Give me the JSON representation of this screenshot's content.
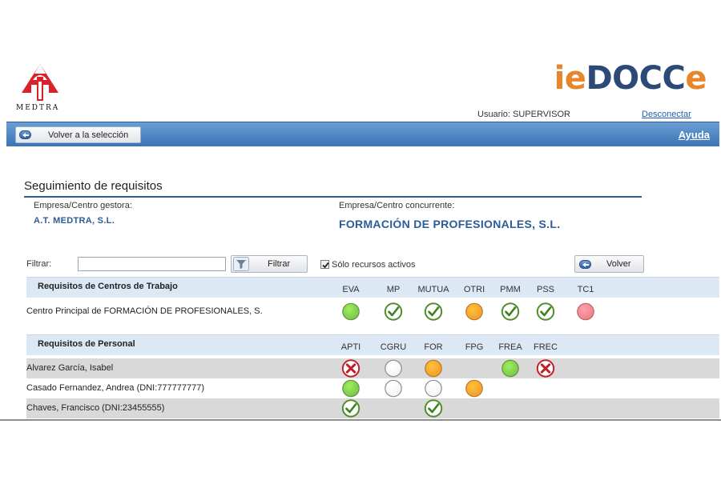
{
  "header": {
    "logo_text": "MEDTRA",
    "brand": {
      "i": "i",
      "doc": "DOC",
      "e": "e"
    },
    "user_label": "Usuario: SUPERVISOR",
    "logout_label": "Desconectar"
  },
  "toolbar": {
    "back_selection_label": "Volver a la selección",
    "help_label": "Ayuda"
  },
  "section": {
    "title": "Seguimiento de requisitos",
    "gestora_label": "Empresa/Centro gestora:",
    "gestora_value": "A.T. MEDTRA, S.L.",
    "concurrente_label": "Empresa/Centro concurrente:",
    "concurrente_value": "FORMACIÓN DE PROFESIONALES, S.L."
  },
  "filter": {
    "label": "Filtrar:",
    "value": "",
    "button_label": "Filtrar",
    "active_only_label": "Sólo recursos activos",
    "active_only_checked": true,
    "back_label": "Volver"
  },
  "status_legend": {
    "ok": "check-icon",
    "fail": "cross-icon",
    "green": "#7cc04a",
    "orange": "#f29a2e",
    "red": "#ee7f88",
    "white": "#f4f4f4"
  },
  "work_centers": {
    "title": "Requisitos de Centros de Trabajo",
    "columns": [
      "EVA",
      "MP",
      "MUTUA",
      "OTRI",
      "PMM",
      "PSS",
      "TC1"
    ],
    "rows": [
      {
        "name": "Centro Principal de FORMACIÓN DE PROFESIONALES, S.",
        "statuses": [
          "green",
          "ok",
          "ok",
          "orange",
          "ok",
          "ok",
          "red"
        ]
      }
    ]
  },
  "personnel": {
    "title": "Requisitos de Personal",
    "columns": [
      "APTI",
      "CGRU",
      "FOR",
      "FPG",
      "FREA",
      "FREC"
    ],
    "rows": [
      {
        "name": "Alvarez García, Isabel",
        "statuses": [
          "fail",
          "white",
          "orange",
          "",
          "green",
          "fail"
        ]
      },
      {
        "name": "Casado Fernandez, Andrea (DNI:777777777)",
        "statuses": [
          "green",
          "white",
          "white",
          "orange",
          "",
          ""
        ]
      },
      {
        "name": "Chaves, Francisco (DNI:23455555)",
        "statuses": [
          "ok",
          "",
          "ok",
          "",
          "",
          ""
        ]
      }
    ]
  }
}
